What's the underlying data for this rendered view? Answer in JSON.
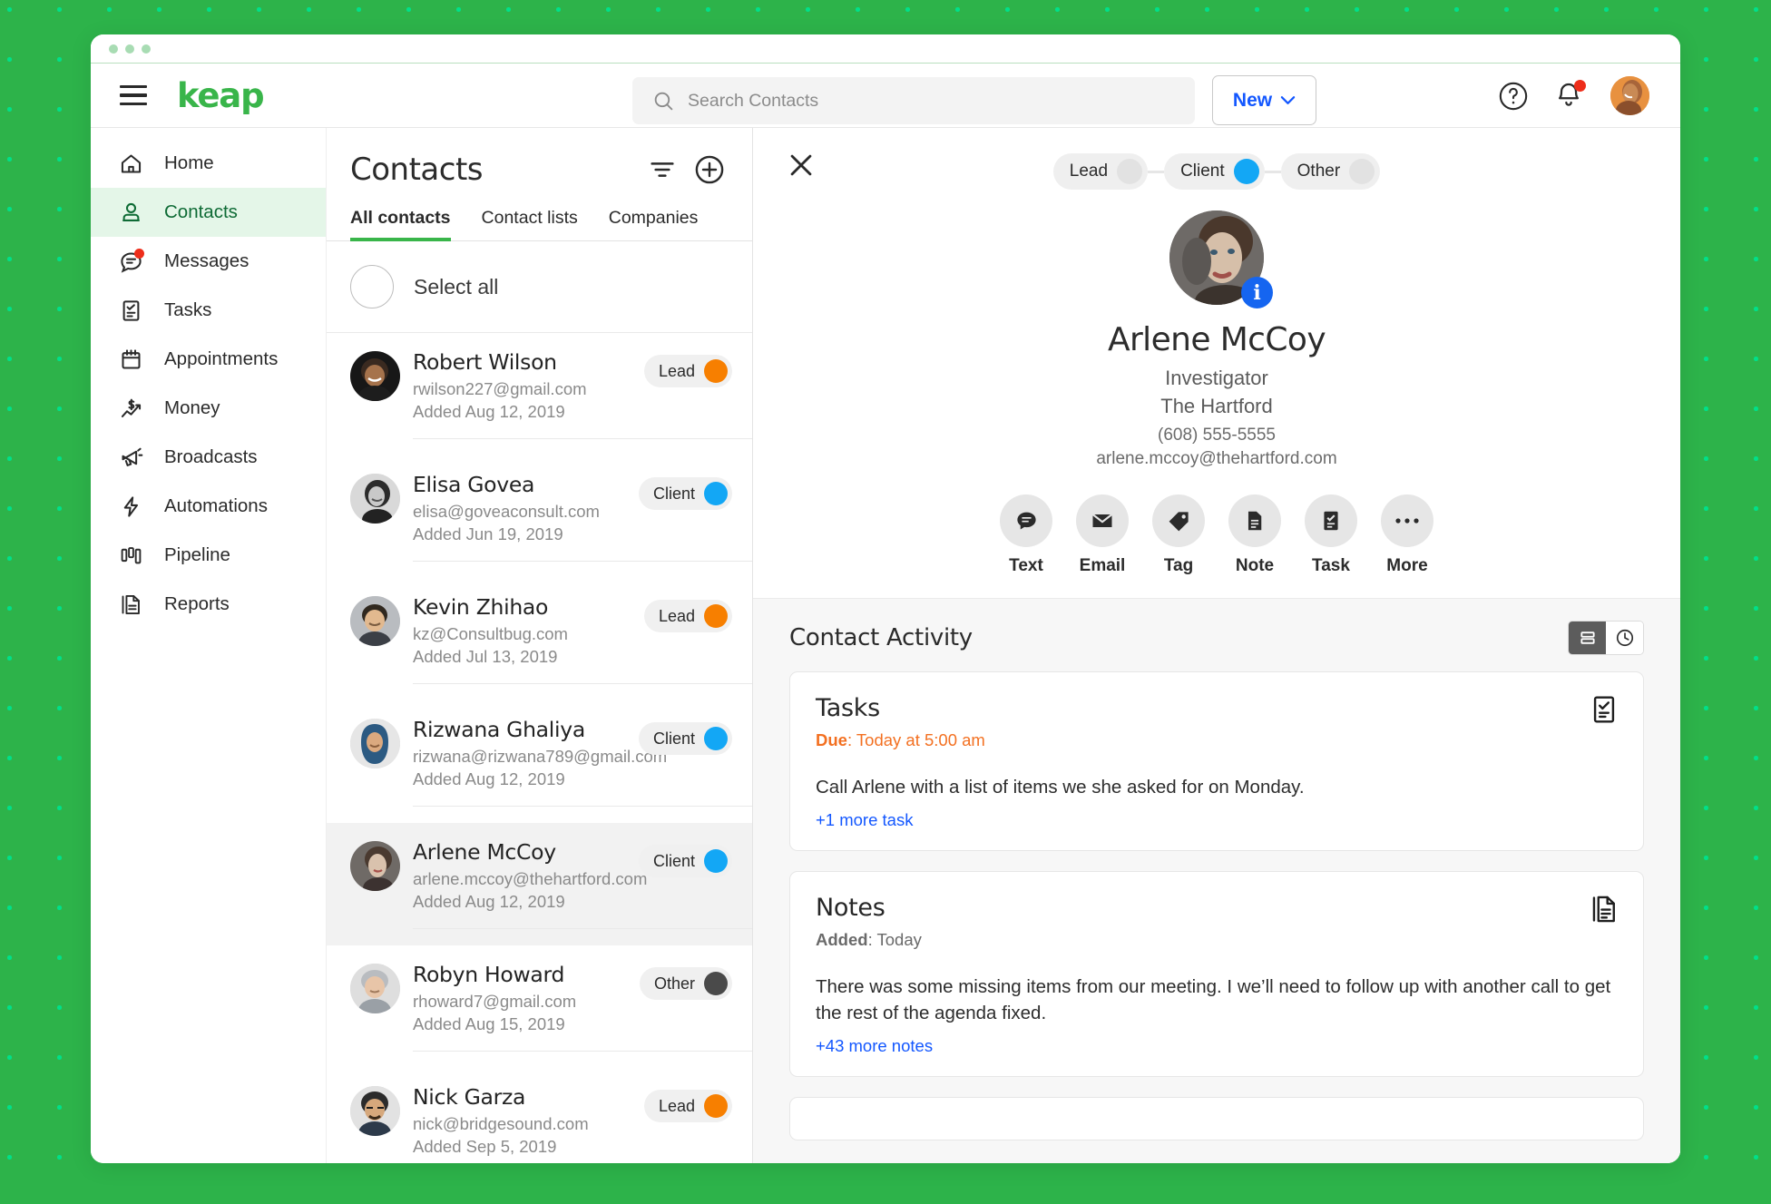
{
  "theme": {
    "brand_green": "#39b54a",
    "bg_green": "#2db34a",
    "accent_blue": "#1357ff",
    "lead_orange": "#f77f00",
    "client_blue": "#13a7f5",
    "other_gray": "#4a4a4a",
    "due_orange": "#f37021"
  },
  "header": {
    "logo": "keap",
    "menu_icon": "hamburger-icon",
    "search": {
      "placeholder": "Search Contacts",
      "value": "",
      "icon": "search-icon"
    },
    "new_button": {
      "label": "New",
      "icon": "chevron-down-icon"
    },
    "help_icon": "help-circle-icon",
    "notifications_icon": "bell-icon",
    "avatar": "user-avatar"
  },
  "sidebar": {
    "items": [
      {
        "label": "Home",
        "icon": "home-icon",
        "active": false,
        "badge": false
      },
      {
        "label": "Contacts",
        "icon": "person-icon",
        "active": true,
        "badge": false
      },
      {
        "label": "Messages",
        "icon": "chat-bubble-icon",
        "active": false,
        "badge": true
      },
      {
        "label": "Tasks",
        "icon": "checklist-icon",
        "active": false,
        "badge": false
      },
      {
        "label": "Appointments",
        "icon": "calendar-icon",
        "active": false,
        "badge": false
      },
      {
        "label": "Money",
        "icon": "dollar-chart-icon",
        "active": false,
        "badge": false
      },
      {
        "label": "Broadcasts",
        "icon": "megaphone-icon",
        "active": false,
        "badge": false
      },
      {
        "label": "Automations",
        "icon": "lightning-bolt-icon",
        "active": false,
        "badge": false
      },
      {
        "label": "Pipeline",
        "icon": "pipeline-bars-icon",
        "active": false,
        "badge": false
      },
      {
        "label": "Reports",
        "icon": "report-document-icon",
        "active": false,
        "badge": false
      }
    ]
  },
  "contacts_panel": {
    "title": "Contacts",
    "filter_icon": "filter-icon",
    "add_icon": "plus-circle-icon",
    "tabs": [
      {
        "label": "All contacts",
        "active": true
      },
      {
        "label": "Contact lists",
        "active": false
      },
      {
        "label": "Companies",
        "active": false
      }
    ],
    "select_all_label": "Select all",
    "rows": [
      {
        "name": "Robert Wilson",
        "email": "rwilson227@gmail.com",
        "added": "Added Aug 12, 2019",
        "tag": "Lead",
        "tag_color": "#f77f00",
        "selected": false
      },
      {
        "name": "Elisa Govea",
        "email": "elisa@goveaconsult.com",
        "added": "Added Jun 19, 2019",
        "tag": "Client",
        "tag_color": "#13a7f5",
        "selected": false
      },
      {
        "name": "Kevin Zhihao",
        "email": "kz@Consultbug.com",
        "added": "Added Jul 13, 2019",
        "tag": "Lead",
        "tag_color": "#f77f00",
        "selected": false
      },
      {
        "name": "Rizwana Ghaliya",
        "email": "rizwana@rizwana789@gmail.com",
        "added": "Added Aug 12, 2019",
        "tag": "Client",
        "tag_color": "#13a7f5",
        "selected": false
      },
      {
        "name": "Arlene McCoy",
        "email": "arlene.mccoy@thehartford.com",
        "added": "Added Aug 12, 2019",
        "tag": "Client",
        "tag_color": "#13a7f5",
        "selected": true
      },
      {
        "name": "Robyn Howard",
        "email": "rhoward7@gmail.com",
        "added": "Added Aug 15, 2019",
        "tag": "Other",
        "tag_color": "#4a4a4a",
        "selected": false
      },
      {
        "name": "Nick Garza",
        "email": "nick@bridgesound.com",
        "added": "Added Sep 5, 2019",
        "tag": "Lead",
        "tag_color": "#f77f00",
        "selected": false
      }
    ]
  },
  "detail": {
    "close_icon": "close-x-icon",
    "segments": [
      {
        "label": "Lead",
        "active": false
      },
      {
        "label": "Client",
        "active": true
      },
      {
        "label": "Other",
        "active": false
      }
    ],
    "info_badge": "i",
    "name": "Arlene McCoy",
    "job_title": "Investigator",
    "company": "The Hartford",
    "phone": "(608) 555-5555",
    "email": "arlene.mccoy@thehartford.com",
    "actions": [
      {
        "label": "Text",
        "icon": "chat-bubble-icon"
      },
      {
        "label": "Email",
        "icon": "envelope-icon"
      },
      {
        "label": "Tag",
        "icon": "tag-icon"
      },
      {
        "label": "Note",
        "icon": "note-document-icon"
      },
      {
        "label": "Task",
        "icon": "checklist-icon"
      },
      {
        "label": "More",
        "icon": "ellipsis-icon"
      }
    ],
    "activity": {
      "title": "Contact Activity",
      "view_list_icon": "list-view-icon",
      "view_timeline_icon": "clock-icon",
      "active_view": "list",
      "cards": [
        {
          "title": "Tasks",
          "meta_label": "Due",
          "meta_value": "Today at 5:00 am",
          "meta_style": "due",
          "body": "Call Arlene with a list of items we she asked for on Monday.",
          "more": "+1 more task",
          "icon": "checklist-icon"
        },
        {
          "title": "Notes",
          "meta_label": "Added",
          "meta_value": "Today",
          "meta_style": "added",
          "body": "There was some missing items from our meeting. I we’ll need to follow up with another call to get the rest of the agenda fixed.",
          "more": "+43 more notes",
          "icon": "note-document-icon"
        }
      ]
    }
  }
}
